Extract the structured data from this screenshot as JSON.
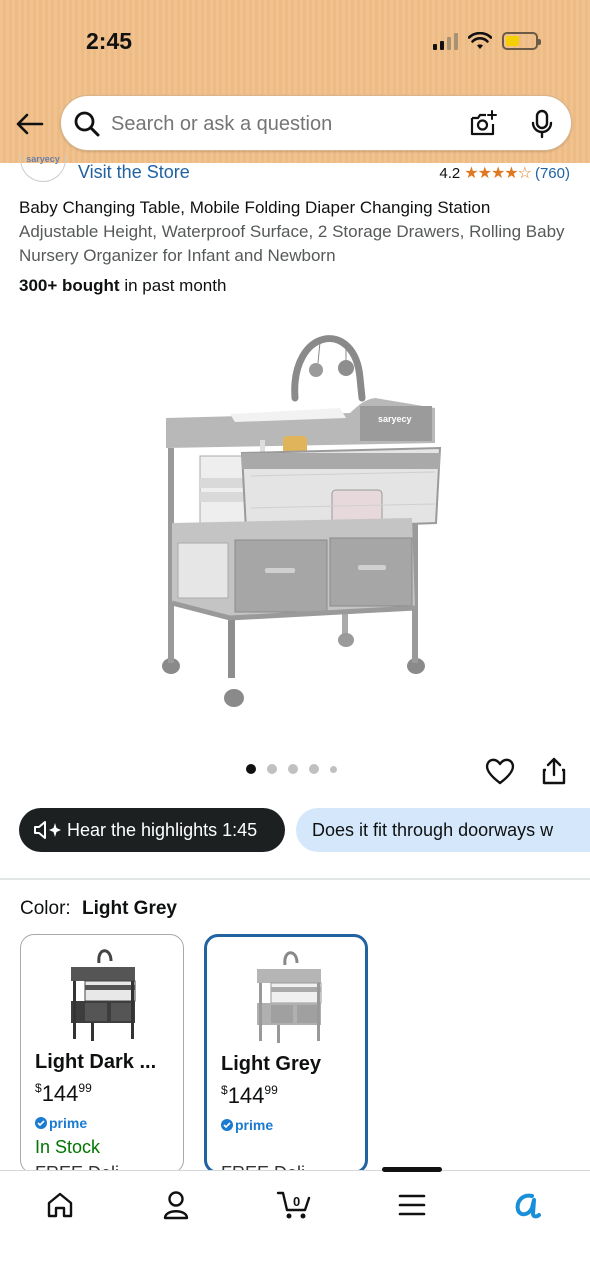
{
  "status_bar": {
    "time": "2:45"
  },
  "search": {
    "placeholder": "Search or ask a question"
  },
  "store": {
    "logo_text": "saryecy",
    "visit_label": "Visit the Store",
    "rating": "4.2",
    "stars": "★★★★☆",
    "review_count": "(760)"
  },
  "product": {
    "title": "Baby Changing Table, Mobile Folding Diaper Changing Station",
    "subtitle": "Adjustable Height, Waterproof Surface, 2 Storage Drawers, Rolling Baby Nursery Organizer for Infant and Newborn",
    "bought_bold": "300+ bought",
    "bought_rest": "in past month",
    "image_brand": "saryecy",
    "image_count": 5,
    "active_image": 1
  },
  "pills": {
    "highlights": "Hear the highlights 1:45",
    "question": "Does it fit through doorways w"
  },
  "color": {
    "label": "Color:",
    "selected": "Light Grey",
    "options": [
      {
        "name": "Light Dark ...",
        "currency": "$",
        "price_whole": "144",
        "price_cents": "99",
        "prime": "prime",
        "stock": "In Stock",
        "delivery": "FREE Deli"
      },
      {
        "name": "Light Grey",
        "currency": "$",
        "price_whole": "144",
        "price_cents": "99",
        "prime": "prime",
        "delivery": "FREE Deli"
      }
    ]
  },
  "colors": {
    "header": "#f1c28e",
    "link": "#2162a1",
    "star": "#de7921",
    "selected_border": "#2162a1",
    "stock": "#007600",
    "prime": "#1a7bd0"
  },
  "icons": [
    "back-arrow-icon",
    "search-icon",
    "camera-icon",
    "microphone-icon",
    "heart-icon",
    "share-icon",
    "speaker-icon",
    "home-icon",
    "account-icon",
    "cart-icon",
    "menu-icon",
    "rufus-icon"
  ]
}
